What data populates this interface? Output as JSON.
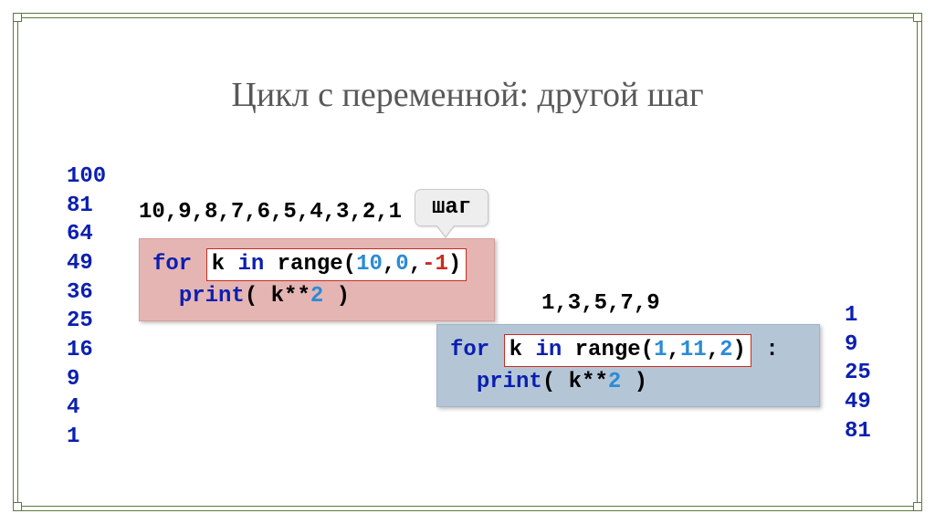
{
  "title": "Цикл с переменной: другой шаг",
  "step_label": "шаг",
  "seq1": "10,9,8,7,6,5,4,3,2,1",
  "seq2": "1,3,5,7,9",
  "out_left": [
    "100",
    "81",
    "64",
    "49",
    "36",
    "25",
    "16",
    "9",
    "4",
    "1"
  ],
  "out_right": [
    "1",
    "9",
    "25",
    "49",
    "81"
  ],
  "code1": {
    "for_kw": "for",
    "var": "k",
    "in_kw": "in",
    "range_fn": "range",
    "arg1": "10",
    "arg2": "0",
    "arg3": "-1",
    "print_kw": "print",
    "expr_open": "( ",
    "expr": "k**",
    "expr_num": "2",
    "expr_close": " )"
  },
  "code2": {
    "for_kw": "for",
    "var": "k",
    "in_kw": "in",
    "range_fn": "range",
    "arg1": "1",
    "arg2": "11",
    "arg3": "2",
    "trailing_colon": ":",
    "print_kw": "print",
    "expr_open": "( ",
    "expr": "k**",
    "expr_num": "2",
    "expr_close": " )"
  }
}
